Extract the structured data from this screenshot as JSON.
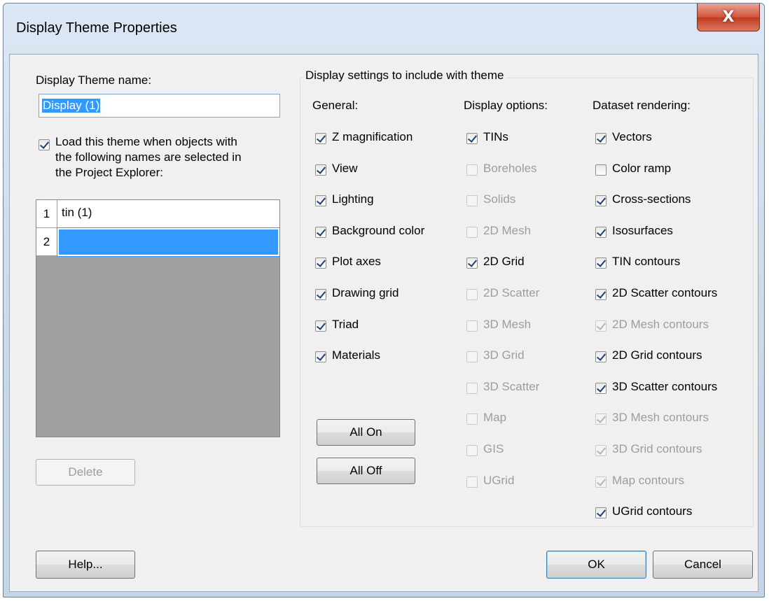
{
  "window": {
    "title": "Display Theme Properties",
    "close_glyph": "X"
  },
  "left": {
    "name_label": "Display Theme name:",
    "name_value": "Display (1)",
    "load_checkbox_checked": true,
    "load_label_lines": [
      "Load this theme when objects with",
      "the following names are selected in",
      "the Project Explorer:"
    ],
    "grid_rows": [
      {
        "num": "1",
        "value": "tin (1)"
      },
      {
        "num": "2",
        "value": ""
      }
    ],
    "delete_label": "Delete"
  },
  "group": {
    "title": "Display settings to include with theme",
    "columns": [
      {
        "header": "General:",
        "items": [
          {
            "label": "Z magnification",
            "checked": true,
            "enabled": true
          },
          {
            "label": "View",
            "checked": true,
            "enabled": true
          },
          {
            "label": "Lighting",
            "checked": true,
            "enabled": true
          },
          {
            "label": "Background color",
            "checked": true,
            "enabled": true
          },
          {
            "label": "Plot axes",
            "checked": true,
            "enabled": true
          },
          {
            "label": "Drawing grid",
            "checked": true,
            "enabled": true
          },
          {
            "label": "Triad",
            "checked": true,
            "enabled": true
          },
          {
            "label": "Materials",
            "checked": true,
            "enabled": true
          }
        ]
      },
      {
        "header": "Display options:",
        "items": [
          {
            "label": "TINs",
            "checked": true,
            "enabled": true
          },
          {
            "label": "Boreholes",
            "checked": false,
            "enabled": false
          },
          {
            "label": "Solids",
            "checked": false,
            "enabled": false
          },
          {
            "label": "2D Mesh",
            "checked": false,
            "enabled": false
          },
          {
            "label": "2D Grid",
            "checked": true,
            "enabled": true
          },
          {
            "label": "2D Scatter",
            "checked": false,
            "enabled": false
          },
          {
            "label": "3D Mesh",
            "checked": false,
            "enabled": false
          },
          {
            "label": "3D Grid",
            "checked": false,
            "enabled": false
          },
          {
            "label": "3D Scatter",
            "checked": false,
            "enabled": false
          },
          {
            "label": "Map",
            "checked": false,
            "enabled": false
          },
          {
            "label": "GIS",
            "checked": false,
            "enabled": false
          },
          {
            "label": "UGrid",
            "checked": false,
            "enabled": false
          }
        ]
      },
      {
        "header": "Dataset rendering:",
        "items": [
          {
            "label": "Vectors",
            "checked": true,
            "enabled": true
          },
          {
            "label": "Color ramp",
            "checked": false,
            "enabled": true
          },
          {
            "label": "Cross-sections",
            "checked": true,
            "enabled": true
          },
          {
            "label": "Isosurfaces",
            "checked": true,
            "enabled": true
          },
          {
            "label": "TIN contours",
            "checked": true,
            "enabled": true
          },
          {
            "label": "2D Scatter contours",
            "checked": true,
            "enabled": true
          },
          {
            "label": "2D Mesh contours",
            "checked": true,
            "enabled": false
          },
          {
            "label": "2D Grid contours",
            "checked": true,
            "enabled": true
          },
          {
            "label": "3D Scatter contours",
            "checked": true,
            "enabled": true
          },
          {
            "label": "3D Mesh contours",
            "checked": true,
            "enabled": false
          },
          {
            "label": "3D Grid contours",
            "checked": true,
            "enabled": false
          },
          {
            "label": "Map contours",
            "checked": true,
            "enabled": false
          },
          {
            "label": "UGrid contours",
            "checked": true,
            "enabled": true
          }
        ]
      }
    ],
    "all_on_label": "All On",
    "all_off_label": "All Off"
  },
  "footer": {
    "help_label": "Help...",
    "ok_label": "OK",
    "cancel_label": "Cancel"
  }
}
